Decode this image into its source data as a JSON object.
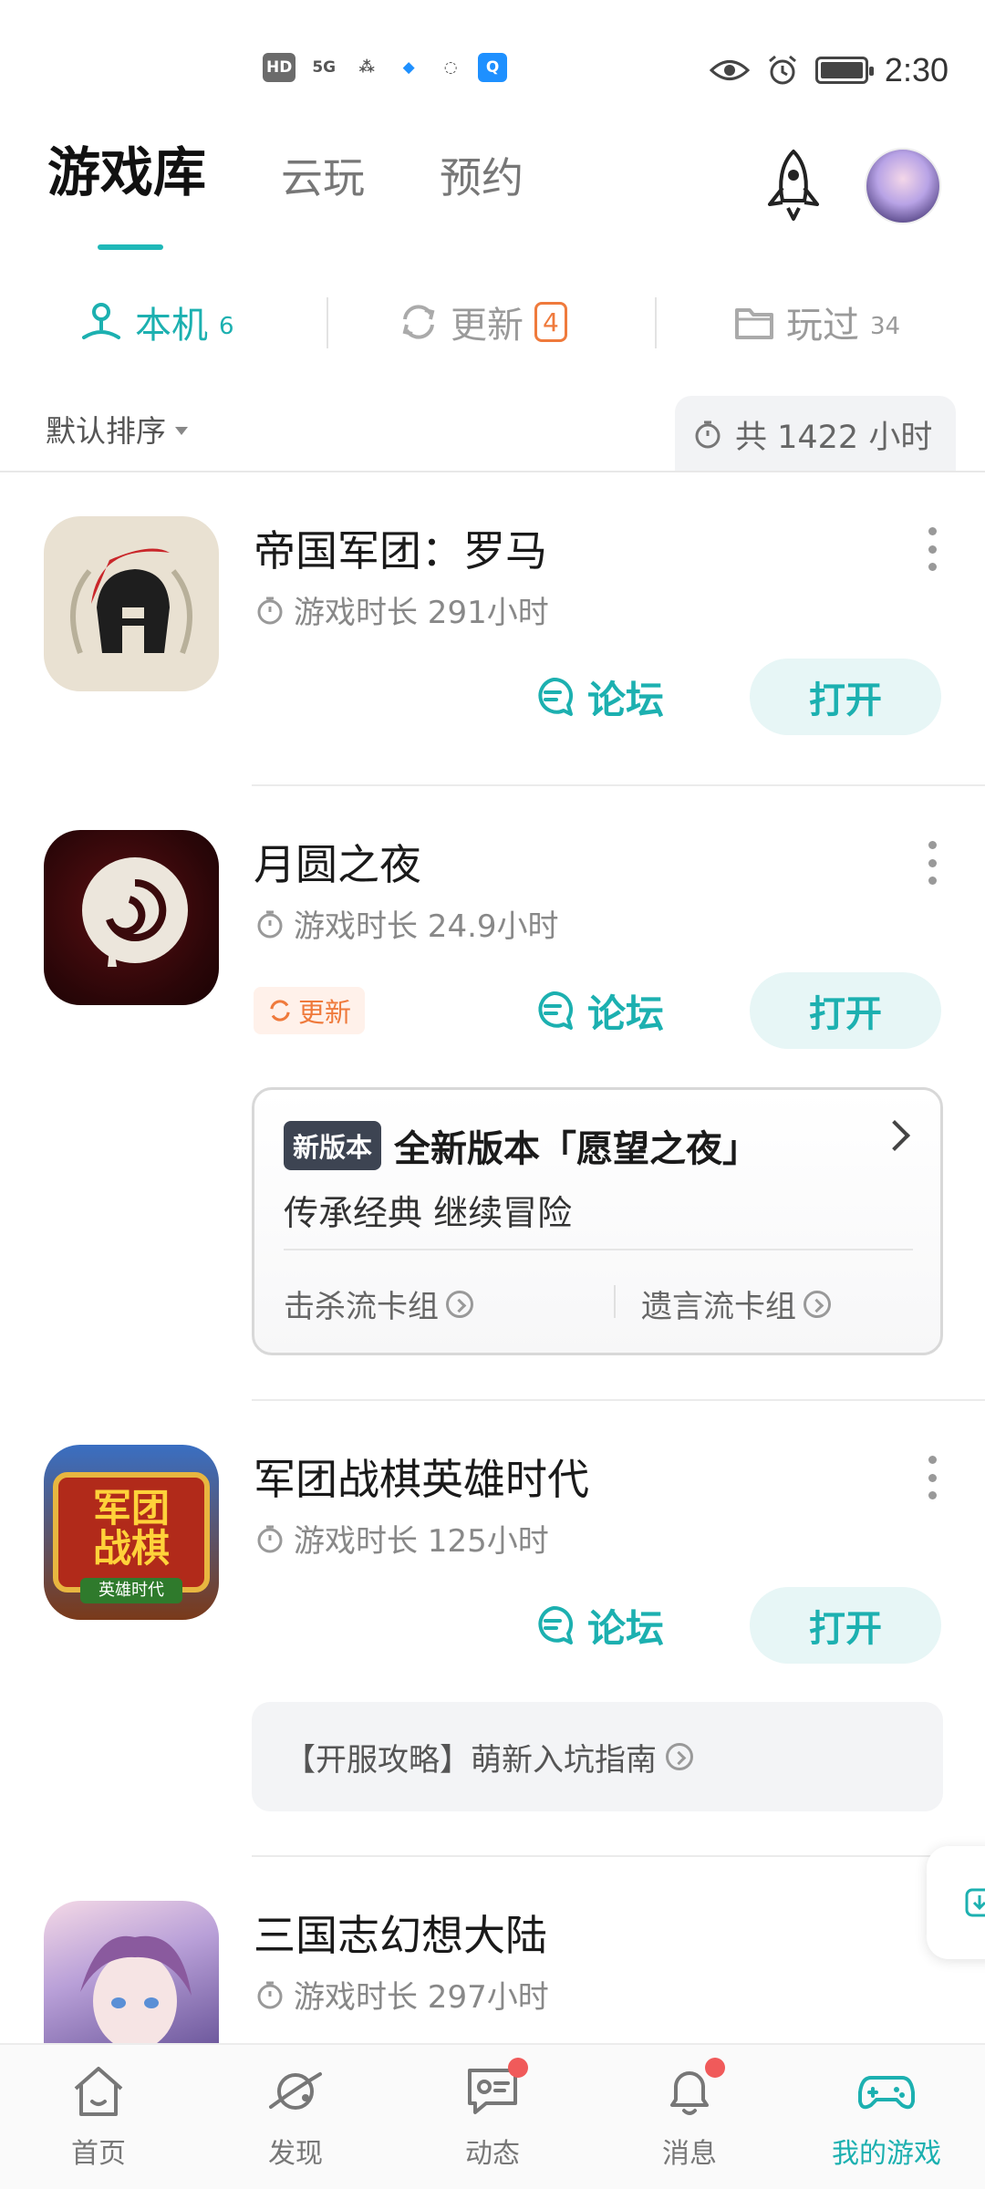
{
  "status_bar": {
    "time": "2:30",
    "chips": [
      "HD",
      "5G",
      "⁂",
      "◆",
      "◌",
      "Q"
    ]
  },
  "header": {
    "tabs": [
      {
        "label": "游戏库",
        "active": true
      },
      {
        "label": "云玩",
        "active": false
      },
      {
        "label": "预约",
        "active": false
      }
    ]
  },
  "sub_tabs": {
    "local": {
      "label": "本机",
      "count": "6"
    },
    "update": {
      "label": "更新",
      "count": "4"
    },
    "played": {
      "label": "玩过",
      "count": "34"
    }
  },
  "sort": {
    "label": "默认排序"
  },
  "total": {
    "text": "共 1422 小时"
  },
  "games": [
    {
      "title": "帝国军团：罗马",
      "playtime": "游戏时长 291小时",
      "forum_label": "论坛",
      "open_label": "打开"
    },
    {
      "title": "月圆之夜",
      "playtime": "游戏时长 24.9小时",
      "forum_label": "论坛",
      "open_label": "打开",
      "update_label": "更新"
    },
    {
      "title": "军团战棋英雄时代",
      "playtime": "游戏时长 125小时",
      "forum_label": "论坛",
      "open_label": "打开"
    },
    {
      "title": "三国志幻想大陆",
      "playtime": "游戏时长 297小时"
    }
  ],
  "icon_texts": {
    "game3_line1": "军团",
    "game3_line2": "战棋",
    "game3_line3": "英雄时代"
  },
  "news_card": {
    "badge": "新版本",
    "title": "全新版本「愿望之夜」",
    "subtitle": "传承经典 继续冒险",
    "link_left": "击杀流卡组",
    "link_right": "遗言流卡组"
  },
  "guide": {
    "text": "【开服攻略】萌新入坑指南"
  },
  "bottom_nav": [
    {
      "label": "首页",
      "icon": "home-icon"
    },
    {
      "label": "发现",
      "icon": "planet-icon"
    },
    {
      "label": "动态",
      "icon": "chat-icon"
    },
    {
      "label": "消息",
      "icon": "bell-icon"
    },
    {
      "label": "我的游戏",
      "icon": "gamepad-icon"
    }
  ],
  "colors": {
    "accent": "#1cb0b0",
    "update": "#ef7a3c",
    "badge_dark": "#3d4452",
    "notify": "#f05a5a"
  }
}
